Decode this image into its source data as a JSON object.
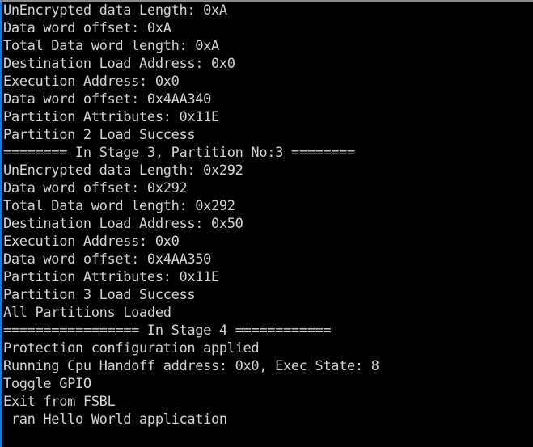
{
  "terminal": {
    "colors": {
      "background": "#000000",
      "foreground": "#d2d2d2",
      "accent_bar": "#1f78d1",
      "top_edge": "#8a8a8a",
      "cursor": "#00e000"
    },
    "cursor": {
      "visible": true,
      "glyph": "block-cursor",
      "line_index": 24
    },
    "lines": [
      "UnEncrypted data Length: 0xA",
      "Data word offset: 0xA",
      "Total Data word length: 0xA",
      "Destination Load Address: 0x0",
      "Execution Address: 0x0",
      "Data word offset: 0x4AA340",
      "Partition Attributes: 0x11E",
      "Partition 2 Load Success",
      "======== In Stage 3, Partition No:3 ========",
      "UnEncrypted data Length: 0x292",
      "Data word offset: 0x292",
      "Total Data word length: 0x292",
      "Destination Load Address: 0x50",
      "Execution Address: 0x0",
      "Data word offset: 0x4AA350",
      "Partition Attributes: 0x11E",
      "Partition 3 Load Success",
      "All Partitions Loaded",
      "================= In Stage 4 ============",
      "Protection configuration applied",
      "Running Cpu Handoff address: 0x0, Exec State: 8",
      "Toggle GPIO",
      "Exit from FSBL",
      " ran Hello World application"
    ]
  }
}
